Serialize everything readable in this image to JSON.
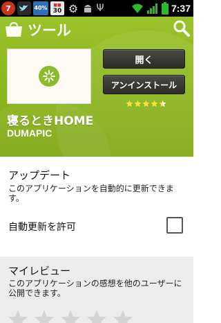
{
  "status_bar": {
    "notification_count": "7",
    "badge_40": "40%",
    "badge_30": "30",
    "time": "7:37",
    "icons": [
      "notification-icon",
      "twitter-icon",
      "battery-40-icon",
      "calendar-icon",
      "settings-icon",
      "android-icon",
      "usb-icon",
      "wifi-icon",
      "signal-icon",
      "battery-icon"
    ]
  },
  "header": {
    "title": "ツール",
    "app_name": "寝るときHOME",
    "developer": "DUMAPIC",
    "open_button": "開く",
    "uninstall_button": "アンインストール",
    "rating": 4.5,
    "background_color": "#8bb51e"
  },
  "update": {
    "title": "アップデート",
    "description": "このアプリケーションを自動的に更新できます。",
    "auto_update_label": "自動更新を許可",
    "auto_update_checked": false
  },
  "review": {
    "title": "マイレビュー",
    "description": "このアプリケーションの感想を他のユーザーに公開できます。",
    "user_rating": 0,
    "max_rating": 5
  }
}
